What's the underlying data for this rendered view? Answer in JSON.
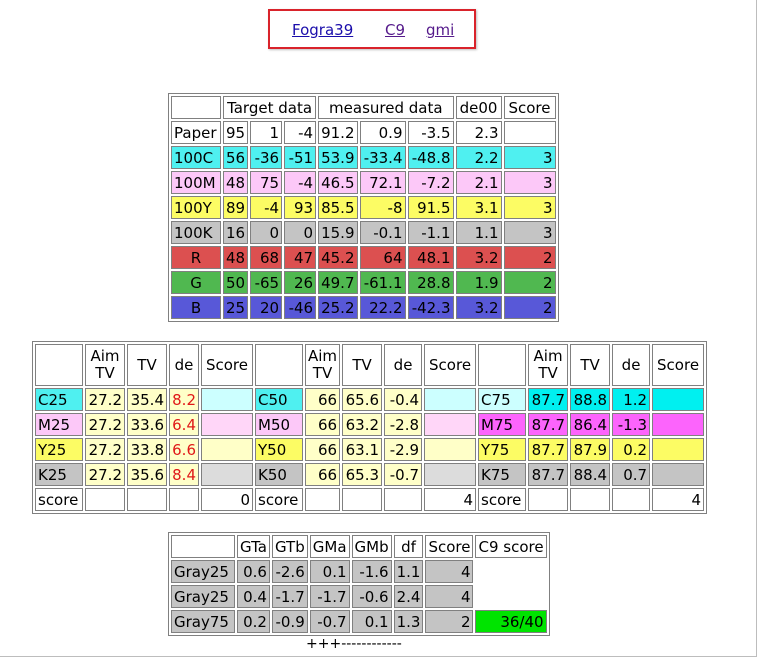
{
  "links": [
    "Fogra39",
    "C9",
    "gmi"
  ],
  "t1": {
    "headers": [
      "",
      "Target data",
      "measured data",
      "de00",
      "Score"
    ],
    "rows": [
      {
        "label": "Paper",
        "target": [
          "95",
          "1",
          "-4"
        ],
        "measured": [
          "91.2",
          "0.9",
          "-3.5"
        ],
        "de": "2.3",
        "score": ""
      },
      {
        "label": "100C",
        "target": [
          "56",
          "-36",
          "-51"
        ],
        "measured": [
          "53.9",
          "-33.4",
          "-48.8"
        ],
        "de": "2.2",
        "score": "3"
      },
      {
        "label": "100M",
        "target": [
          "48",
          "75",
          "-4"
        ],
        "measured": [
          "46.5",
          "72.1",
          "-7.2"
        ],
        "de": "2.1",
        "score": "3"
      },
      {
        "label": "100Y",
        "target": [
          "89",
          "-4",
          "93"
        ],
        "measured": [
          "85.5",
          "-8",
          "91.5"
        ],
        "de": "3.1",
        "score": "3"
      },
      {
        "label": "100K",
        "target": [
          "16",
          "0",
          "0"
        ],
        "measured": [
          "15.9",
          "-0.1",
          "-1.1"
        ],
        "de": "1.1",
        "score": "3"
      },
      {
        "label": "R",
        "target": [
          "48",
          "68",
          "47"
        ],
        "measured": [
          "45.2",
          "64",
          "48.1"
        ],
        "de": "3.2",
        "score": "2"
      },
      {
        "label": "G",
        "target": [
          "50",
          "-65",
          "26"
        ],
        "measured": [
          "49.7",
          "-61.1",
          "28.8"
        ],
        "de": "1.9",
        "score": "2"
      },
      {
        "label": "B",
        "target": [
          "25",
          "20",
          "-46"
        ],
        "measured": [
          "25.2",
          "22.2",
          "-42.3"
        ],
        "de": "3.2",
        "score": "2"
      }
    ]
  },
  "t2": {
    "headers": [
      "",
      "Aim\nTV",
      "TV",
      "de",
      "Score"
    ],
    "groups": [
      {
        "rows": [
          {
            "label": "C25",
            "aim": "27.2",
            "tv": "35.4",
            "de": "8.2"
          },
          {
            "label": "M25",
            "aim": "27.2",
            "tv": "33.6",
            "de": "6.4"
          },
          {
            "label": "Y25",
            "aim": "27.2",
            "tv": "33.8",
            "de": "6.6"
          },
          {
            "label": "K25",
            "aim": "27.2",
            "tv": "35.6",
            "de": "8.4"
          }
        ],
        "score_label": "score",
        "score": "0"
      },
      {
        "rows": [
          {
            "label": "C50",
            "aim": "66",
            "tv": "65.6",
            "de": "-0.4"
          },
          {
            "label": "M50",
            "aim": "66",
            "tv": "63.2",
            "de": "-2.8"
          },
          {
            "label": "Y50",
            "aim": "66",
            "tv": "63.1",
            "de": "-2.9"
          },
          {
            "label": "K50",
            "aim": "66",
            "tv": "65.3",
            "de": "-0.7"
          }
        ],
        "score_label": "score",
        "score": "4"
      },
      {
        "rows": [
          {
            "label": "C75",
            "aim": "87.7",
            "tv": "88.8",
            "de": "1.2"
          },
          {
            "label": "M75",
            "aim": "87.7",
            "tv": "86.4",
            "de": "-1.3"
          },
          {
            "label": "Y75",
            "aim": "87.7",
            "tv": "87.9",
            "de": "0.2"
          },
          {
            "label": "K75",
            "aim": "87.7",
            "tv": "88.4",
            "de": "0.7"
          }
        ],
        "score_label": "score",
        "score": "4"
      }
    ]
  },
  "t3": {
    "headers": [
      "",
      "GTa",
      "GTb",
      "GMa",
      "GMb",
      "df",
      "Score",
      "C9 score"
    ],
    "rows": [
      {
        "label": "Gray25",
        "vals": [
          "0.6",
          "-2.6",
          "0.1",
          "-1.6",
          "1.1"
        ],
        "score": "4",
        "c9": ""
      },
      {
        "label": "Gray25",
        "vals": [
          "0.4",
          "-1.7",
          "-1.7",
          "-0.6",
          "2.4"
        ],
        "score": "4",
        "c9": ""
      },
      {
        "label": "Gray75",
        "vals": [
          "0.2",
          "-0.9",
          "-0.7",
          "0.1",
          "1.3"
        ],
        "score": "2",
        "c9": "36/40"
      }
    ]
  },
  "footer": "+++------------"
}
